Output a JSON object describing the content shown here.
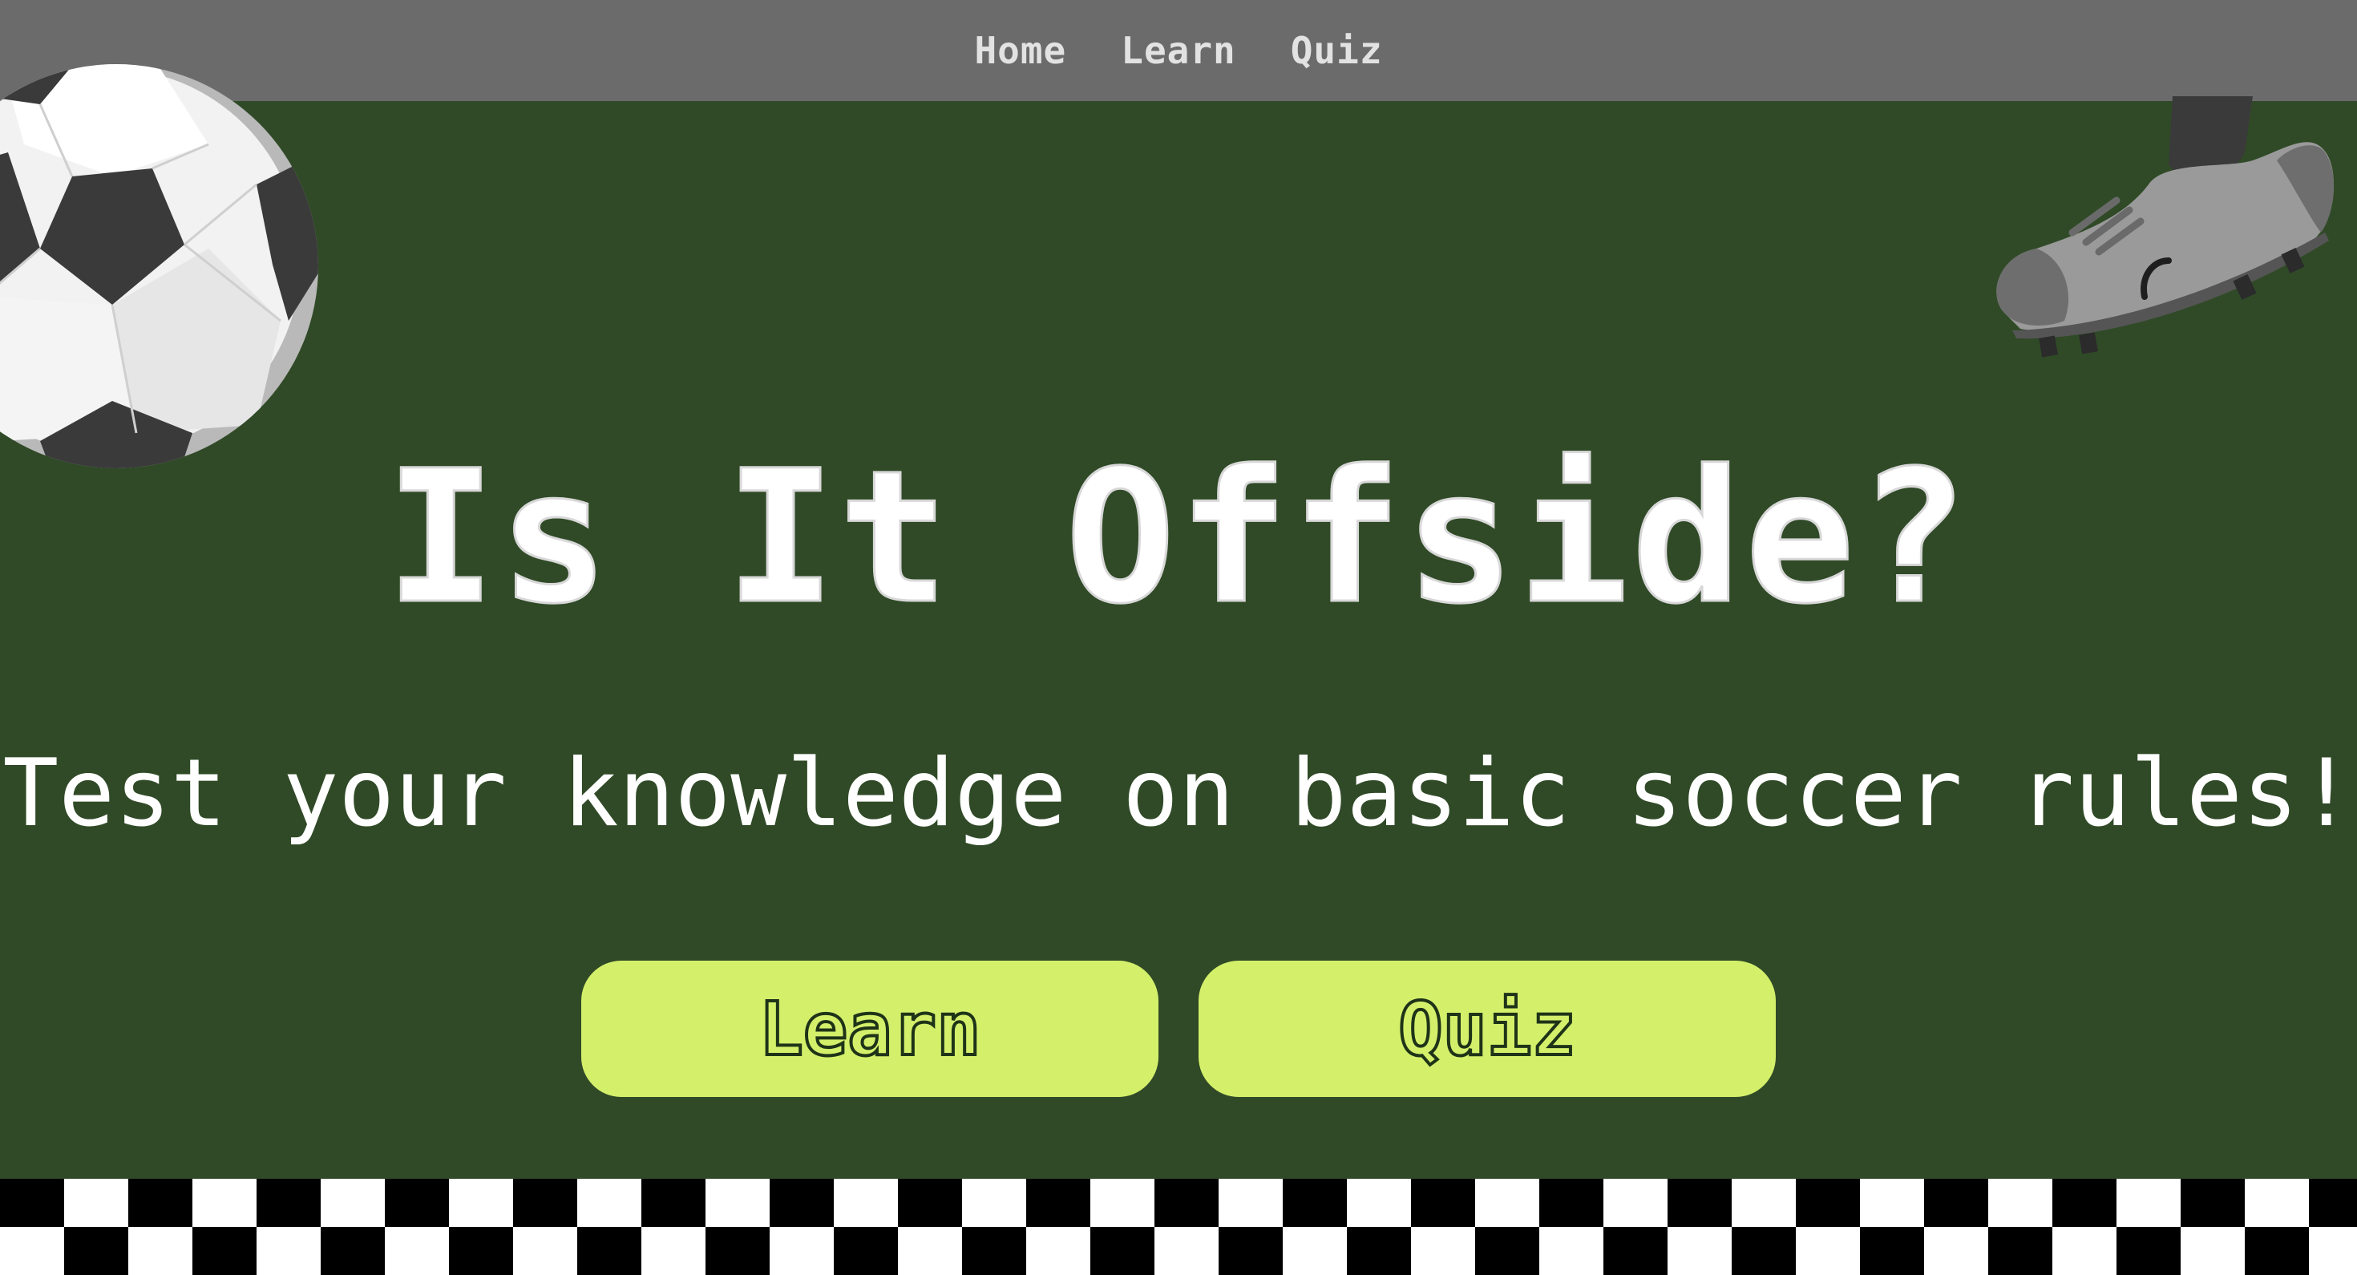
{
  "nav": {
    "items": [
      {
        "label": "Home"
      },
      {
        "label": "Learn"
      },
      {
        "label": "Quiz"
      }
    ]
  },
  "hero": {
    "title": "Is It Offside?",
    "subtitle": "Test your knowledge on basic soccer rules!"
  },
  "buttons": {
    "learn_label": "Learn",
    "quiz_label": "Quiz"
  },
  "decor": {
    "ball_icon": "soccer-ball-icon",
    "boot_icon": "soccer-cleat-icon",
    "footer_pattern": "checkerboard"
  },
  "colors": {
    "background": "#304a27",
    "nav_bar": "#6b6b6b",
    "button": "#d4f06b",
    "text": "#ffffff"
  }
}
